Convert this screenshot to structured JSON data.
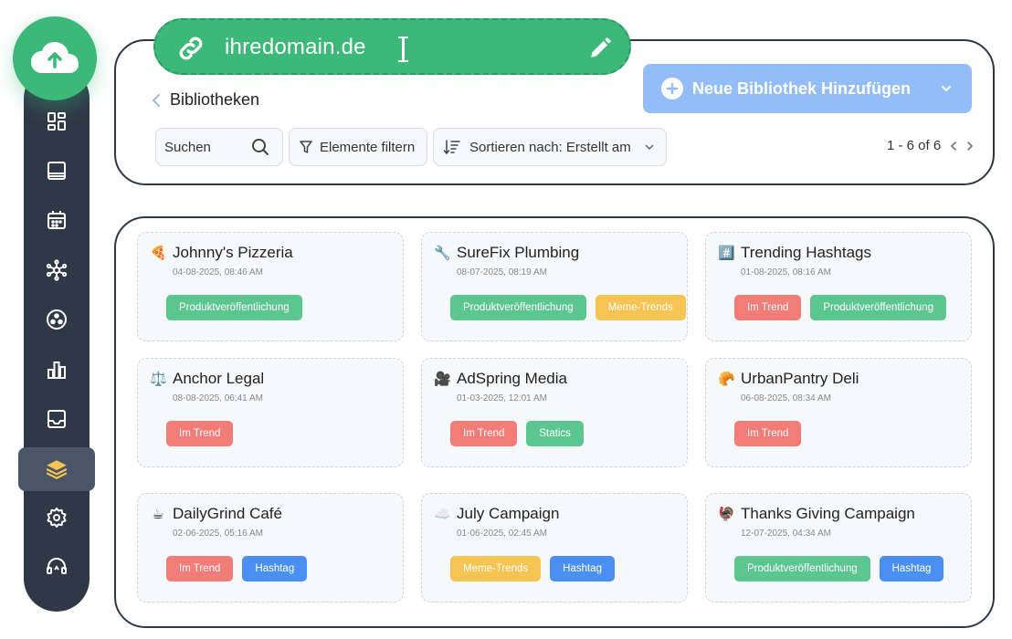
{
  "domain": {
    "text": "ihredomain.de"
  },
  "breadcrumb": {
    "label": "Bibliotheken"
  },
  "toolbar": {
    "add_label": "Neue Bibliothek Hinzufügen",
    "search_label": "Suchen",
    "filter_label": "Elemente filtern",
    "sort_label": "Sortieren nach: Erstellt am",
    "pagination": "1 - 6 of 6"
  },
  "sidebar": {
    "items": [
      {
        "icon": "dashboard-icon"
      },
      {
        "icon": "book-icon"
      },
      {
        "icon": "calendar-icon"
      },
      {
        "icon": "network-icon"
      },
      {
        "icon": "community-icon"
      },
      {
        "icon": "analytics-icon"
      },
      {
        "icon": "inbox-icon"
      },
      {
        "icon": "library-icon",
        "active": true
      },
      {
        "icon": "gear-icon"
      },
      {
        "icon": "support-icon"
      }
    ]
  },
  "colors": {
    "accent_green": "#3cb878",
    "sidebar": "#2f3846",
    "add_button": "#93bdf6",
    "tag_green": "#5cc691",
    "tag_red": "#f27c78",
    "tag_yellow": "#f6c453",
    "tag_blue": "#4a90f2"
  },
  "libraries": [
    {
      "emoji": "🍕",
      "title": "Johnny's Pizzeria",
      "date": "04-08-2025, 08:46 AM",
      "tags": [
        {
          "label": "Produktveröffentlichung",
          "color": "green"
        }
      ]
    },
    {
      "emoji": "🔧",
      "title": "SureFix Plumbing",
      "date": "08-07-2025, 08:19 AM",
      "tags": [
        {
          "label": "Produktveröffentlichung",
          "color": "green"
        },
        {
          "label": "Meme-Trends",
          "color": "yellow"
        }
      ]
    },
    {
      "emoji": "#️⃣",
      "title": "Trending Hashtags",
      "date": "01-08-2025, 08:16 AM",
      "tags": [
        {
          "label": "Im Trend",
          "color": "red"
        },
        {
          "label": "Produktveröffentlichung",
          "color": "green"
        }
      ]
    },
    {
      "emoji": "⚖️",
      "title": "Anchor Legal",
      "date": "08-08-2025, 06:41 AM",
      "tags": [
        {
          "label": "Im Trend",
          "color": "red"
        }
      ]
    },
    {
      "emoji": "🎥",
      "title": "AdSpring Media",
      "date": "01-03-2025, 12:01 AM",
      "tags": [
        {
          "label": "Im Trend",
          "color": "red"
        },
        {
          "label": "Statics",
          "color": "green"
        }
      ]
    },
    {
      "emoji": "🥐",
      "title": "UrbanPantry Deli",
      "date": "06-08-2025, 08:34 AM",
      "tags": [
        {
          "label": "Im Trend",
          "color": "red"
        }
      ]
    },
    {
      "emoji": "☕",
      "title": "DailyGrind Café",
      "date": "02-06-2025, 05:16 AM",
      "tags": [
        {
          "label": "Im Trend",
          "color": "red"
        },
        {
          "label": "Hashtag",
          "color": "blue"
        }
      ]
    },
    {
      "emoji": "☁️",
      "title": "July Campaign",
      "date": "01-06-2025, 02:45 AM",
      "tags": [
        {
          "label": "Meme-Trends",
          "color": "yellow"
        },
        {
          "label": "Hashtag",
          "color": "blue"
        }
      ]
    },
    {
      "emoji": "🦃",
      "title": "Thanks Giving Campaign",
      "date": "12-07-2025, 04:34 AM",
      "tags": [
        {
          "label": "Produktveröffentlichung",
          "color": "green"
        },
        {
          "label": "Hashtag",
          "color": "blue"
        }
      ]
    }
  ]
}
